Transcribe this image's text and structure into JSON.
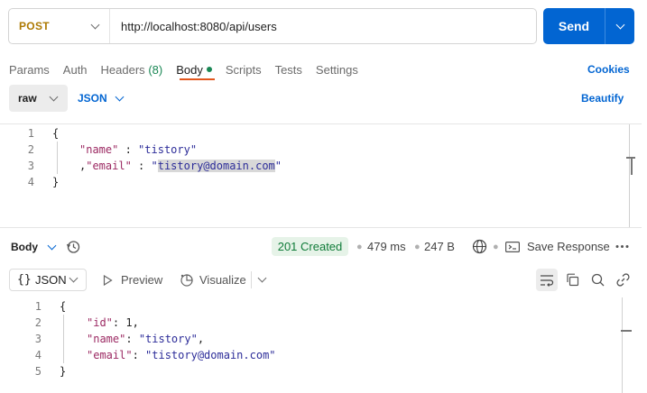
{
  "request": {
    "method": "POST",
    "url": "http://localhost:8080/api/users",
    "send_label": "Send"
  },
  "tabs": [
    {
      "label": "Params"
    },
    {
      "label": "Auth"
    },
    {
      "label": "Headers",
      "count": "(8)"
    },
    {
      "label": "Body",
      "active": true
    },
    {
      "label": "Scripts"
    },
    {
      "label": "Tests"
    },
    {
      "label": "Settings"
    }
  ],
  "cookies_label": "Cookies",
  "body_mode": {
    "mode": "raw",
    "language": "JSON",
    "beautify_label": "Beautify"
  },
  "request_body": {
    "line_numbers": [
      "1",
      "2",
      "3",
      "4"
    ],
    "lines": {
      "l1": "{",
      "l2_key": "\"name\"",
      "l2_sep": " : ",
      "l2_val": "\"tistory\"",
      "l3_prefix": ",",
      "l3_key": "\"email\"",
      "l3_sep": " : ",
      "l3_q1": "\"",
      "l3_sel": "tistory@domain.com",
      "l3_q2": "\"",
      "l4": "}"
    }
  },
  "response": {
    "body_label": "Body",
    "status": "201 Created",
    "time": "479 ms",
    "size": "247 B",
    "save_label": "Save Response",
    "format_label": "JSON",
    "preview_label": "Preview",
    "visualize_label": "Visualize",
    "line_numbers": [
      "1",
      "2",
      "3",
      "4",
      "5"
    ],
    "lines": {
      "l1": "{",
      "l2_key": "\"id\"",
      "l2_rest": ": 1,",
      "l3_key": "\"name\"",
      "l3_sep": ": ",
      "l3_val": "\"tistory\"",
      "l3_comma": ",",
      "l4_key": "\"email\"",
      "l4_sep": ": ",
      "l4_val": "\"tistory@domain.com\"",
      "l5": "}"
    }
  },
  "icons": [
    "chevron-down-icon",
    "history-icon",
    "globe-icon",
    "save-icon",
    "more-icon",
    "braces-icon",
    "play-icon",
    "visualize-icon",
    "wrap-icon",
    "copy-icon",
    "search-icon",
    "link-icon"
  ],
  "colors": {
    "accent": "#0265d2",
    "method": "#ad7a03",
    "status_bg": "#e6f3e8",
    "status_fg": "#0f7b38",
    "active_tab_underline": "#e2571e"
  }
}
